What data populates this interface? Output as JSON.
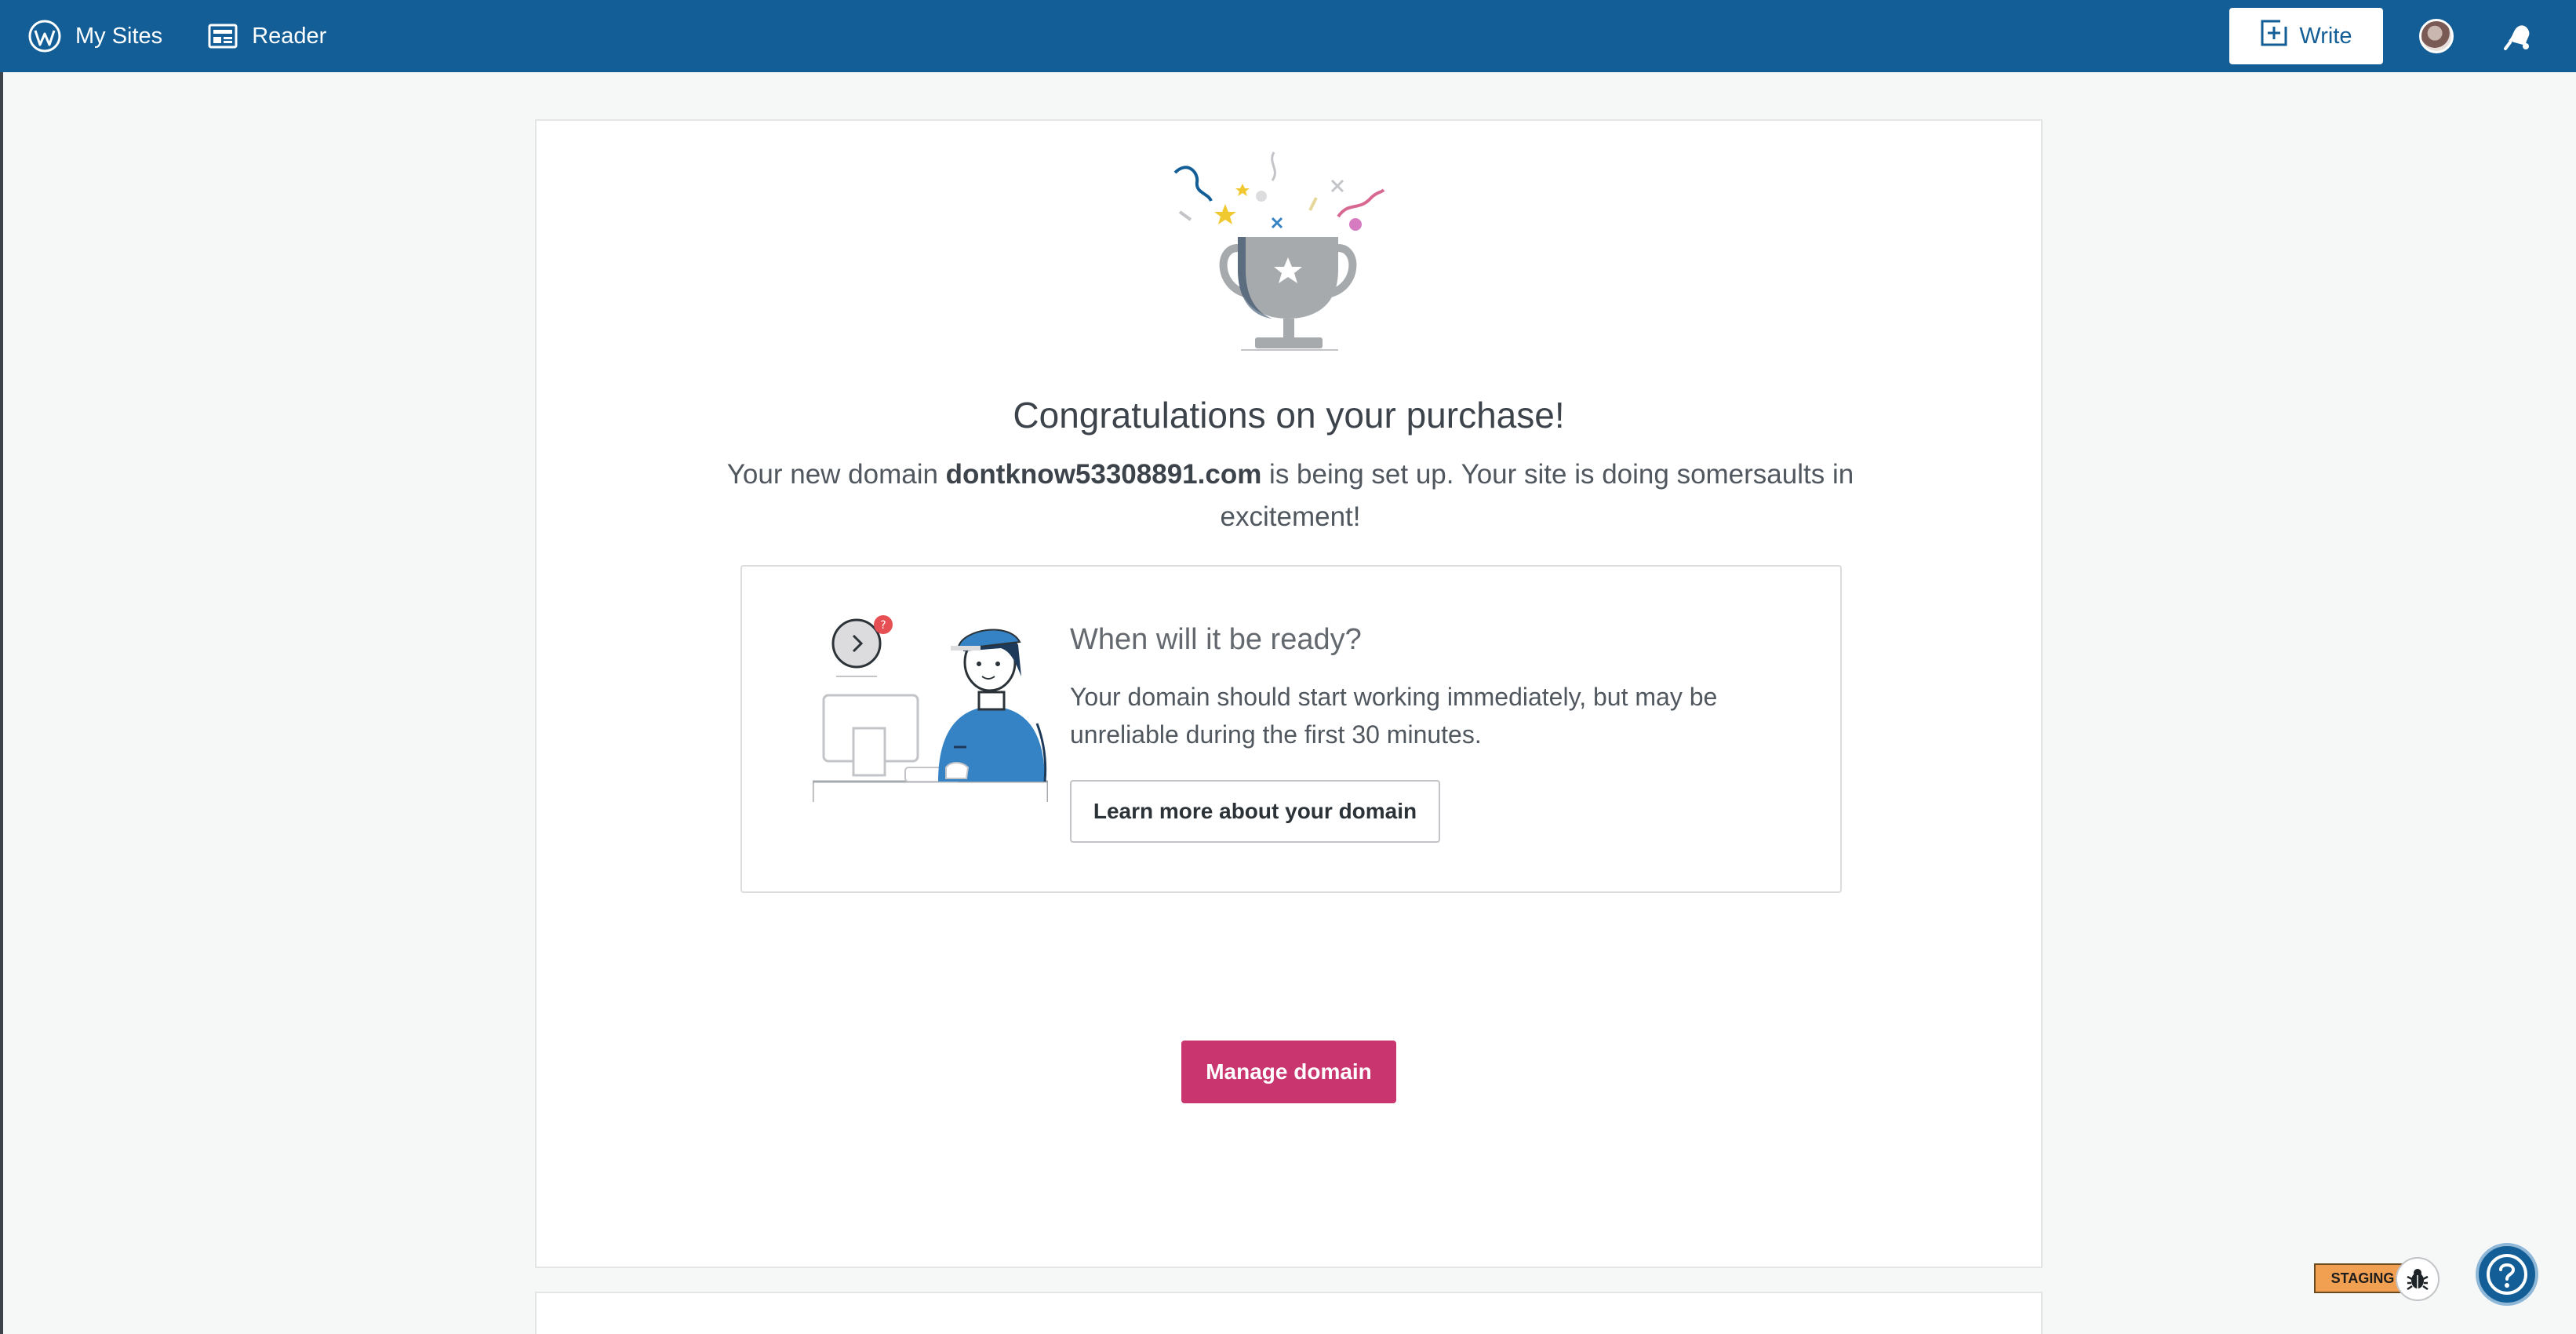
{
  "masterbar": {
    "my_sites_label": "My Sites",
    "reader_label": "Reader",
    "write_label": "Write"
  },
  "purchase": {
    "title": "Congratulations on your purchase!",
    "subtitle_prefix": "Your new domain ",
    "domain": "dontknow53308891.com",
    "subtitle_suffix": " is being set up. Your site is doing somersaults in excitement!"
  },
  "ready_box": {
    "title": "When will it be ready?",
    "body": "Your domain should start working immediately, but may be unreliable during the first 30 minutes.",
    "learn_more_label": "Learn more about your domain"
  },
  "actions": {
    "manage_domain_label": "Manage domain"
  },
  "badges": {
    "staging_label": "STAGING"
  },
  "colors": {
    "masterbar": "#135e96",
    "primary_button": "#c9356e",
    "staging_badge": "#f0a050"
  },
  "icons": [
    "wordpress-icon",
    "reader-icon",
    "write-icon",
    "avatar",
    "notifications-bell-icon",
    "trophy-illustration",
    "support-illustration",
    "bug-icon",
    "help-icon"
  ]
}
